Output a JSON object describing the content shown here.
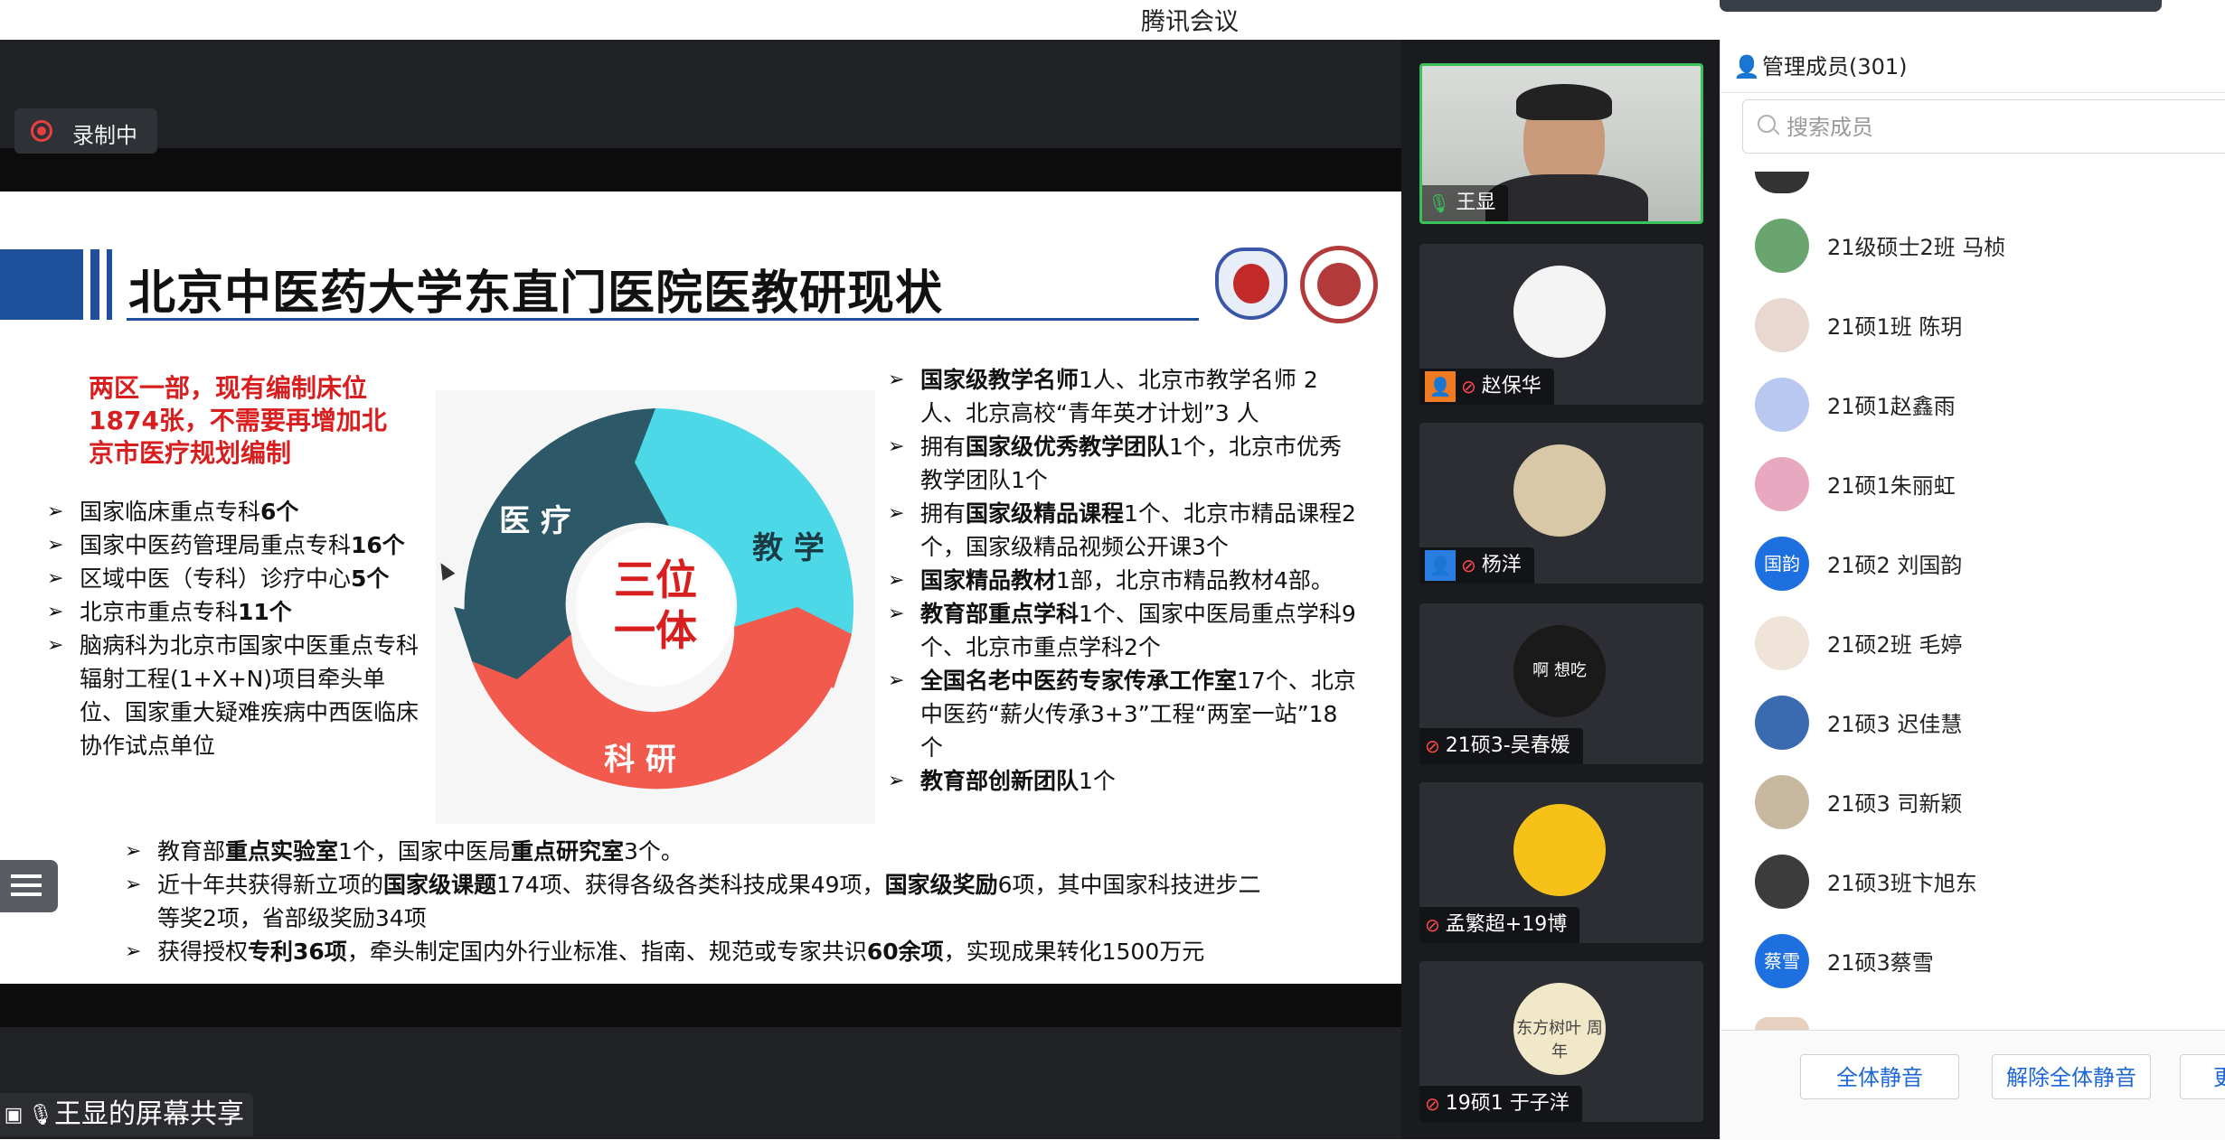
{
  "window": {
    "title": "腾讯会议"
  },
  "recording": {
    "label": "录制中"
  },
  "share": {
    "presenter_label": "王显的屏幕共享"
  },
  "slide": {
    "title": "北京中医药大学东直门医院医教研现状",
    "red_note": "两区一部，现有编制床位1874张，不需要再增加北京市医疗规划编制",
    "cycle": {
      "center_line1": "三位",
      "center_line2": "一体",
      "seg_medical": "医 疗",
      "seg_teaching": "教 学",
      "seg_research": "科 研"
    },
    "left_list": [
      {
        "pre": "国家临床重点专科",
        "b": "6个",
        "post": ""
      },
      {
        "pre": "国家中医药管理局重点专科",
        "b": "16个",
        "post": ""
      },
      {
        "pre": "区域中医（专科）诊疗中心",
        "b": "5个",
        "post": ""
      },
      {
        "pre": "北京市重点专科",
        "b": "11个",
        "post": ""
      },
      {
        "pre": "脑病科为北京市国家中医重点专科辐射工程(1+X+N)项目牵头单位、国家重大疑难疾病中西医临床协作试点单位",
        "b": "",
        "post": ""
      }
    ],
    "right_list": [
      {
        "b": "国家级教学名师",
        "post": "1人、北京市教学名师 2人、北京高校“青年英才计划”3 人"
      },
      {
        "pre": "拥有",
        "b": "国家级优秀教学团队",
        "post": "1个，北京市优秀教学团队1个"
      },
      {
        "pre": "拥有",
        "b": "国家级精品课程",
        "post": "1个、北京市精品课程2个，国家级精品视频公开课3个"
      },
      {
        "b": "国家精品教材",
        "post": "1部，北京市精品教材4部。"
      },
      {
        "b": "教育部重点学科",
        "post": "1个、国家中医局重点学科9个、北京市重点学科2个"
      },
      {
        "b": "全国名老中医药专家传承工作室",
        "post": "17个、北京中医药“薪火传承3+3”工程“两室一站”18个"
      },
      {
        "b": "教育部创新团队",
        "post": "1个"
      }
    ],
    "bottom_list": [
      {
        "p1": "教育部",
        "b1": "重点实验室",
        "p2": "1个，国家中医局",
        "b2": "重点研究室",
        "p3": "3个。",
        "b3": "",
        "p4": ""
      },
      {
        "p1": "近十年共获得新立项的",
        "b1": "国家级课题",
        "p2": "174项、获得各级各类科技成果49项，",
        "b2": "国家级奖励",
        "p3": "6项，其中国家科技进步二等奖2项，省部级奖励34项",
        "b3": "",
        "p4": ""
      },
      {
        "p1": "获得授权",
        "b1": "专利36项",
        "p2": "，牵头制定国内外行业标准、指南、规范或专家共识",
        "b2": "60余项",
        "p3": "，实现成果转化1500万元",
        "b3": "",
        "p4": ""
      }
    ]
  },
  "video_tiles": [
    {
      "name": "王显",
      "mic": "on",
      "host": false,
      "avatar": "video"
    },
    {
      "name": "赵保华",
      "mic": "muted",
      "host": true,
      "host_color": "#f07a22",
      "avatar": "cartoon-bird"
    },
    {
      "name": "杨洋",
      "mic": "muted",
      "host": true,
      "host_color": "#2a7de1",
      "avatar": "panda"
    },
    {
      "name": "21硕3-吴春媛",
      "mic": "muted",
      "host": false,
      "avatar": "sticker",
      "avatar_text": "啊 想吃"
    },
    {
      "name": "孟繁超+19博",
      "mic": "muted",
      "host": false,
      "avatar": "sun"
    },
    {
      "name": "19硕1 于子洋",
      "mic": "muted",
      "host": false,
      "avatar": "photo",
      "avatar_text": "东方树叶 周年"
    }
  ],
  "members_panel": {
    "header": "管理成员(301)",
    "search_placeholder": "搜索成员",
    "members": [
      {
        "name": "21级硕士2班 马桢",
        "avatar": "#6aa56f"
      },
      {
        "name": "21硕1班 陈玥",
        "avatar": "#e8d8d0"
      },
      {
        "name": "21硕1赵鑫雨",
        "avatar": "#b8c8f0"
      },
      {
        "name": "21硕1朱丽虹",
        "avatar": "#e8a8c0"
      },
      {
        "name": "21硕2 刘国韵",
        "avatar": "#1e6fe0",
        "text": "国韵"
      },
      {
        "name": "21硕2班 毛婷",
        "avatar": "#f0e4d8"
      },
      {
        "name": "21硕3 迟佳慧",
        "avatar": "#3a6ab0"
      },
      {
        "name": "21硕3 司新颖",
        "avatar": "#c8b8a0"
      },
      {
        "name": "21硕3班卞旭东",
        "avatar": "#3c3c3c"
      },
      {
        "name": "21硕3蔡雪",
        "avatar": "#1e6fe0",
        "text": "蔡雪"
      }
    ],
    "buttons": [
      "全体静音",
      "解除全体静音",
      "更"
    ]
  }
}
